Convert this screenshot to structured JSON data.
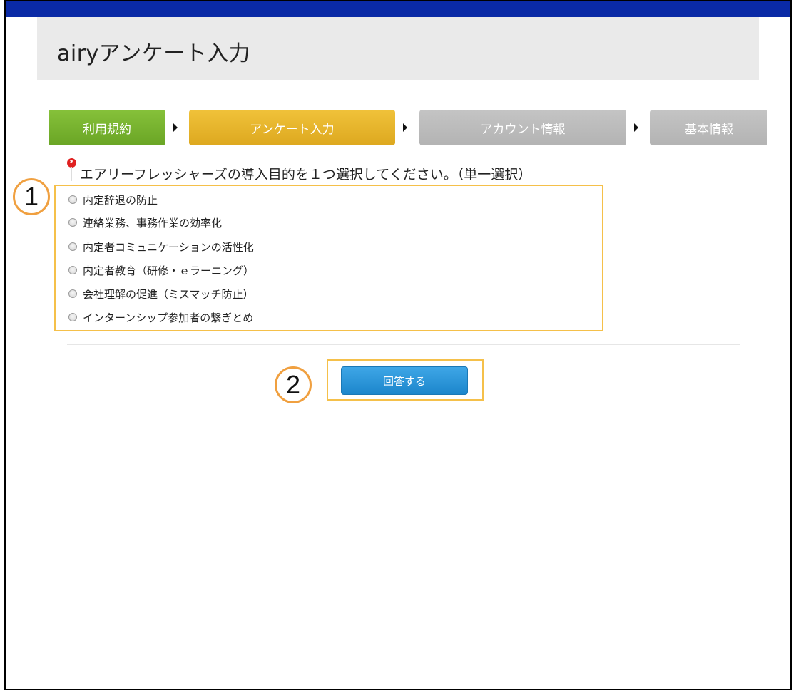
{
  "header": {
    "title": "airyアンケート入力"
  },
  "steps": [
    {
      "label": "利用規約",
      "state": "done",
      "color": "#7cb534"
    },
    {
      "label": "アンケート入力",
      "state": "current",
      "color": "#e8b92c"
    },
    {
      "label": "アカウント情報",
      "state": "upcoming",
      "color": "#bdbdbd"
    },
    {
      "label": "基本情報",
      "state": "upcoming",
      "color": "#bdbdbd"
    }
  ],
  "question": {
    "required_icon": "required-icon",
    "text": "エアリーフレッシャーズの導入目的を１つ選択してください。（単一選択）",
    "options": [
      {
        "label": "内定辞退の防止",
        "selected": false
      },
      {
        "label": "連絡業務、事務作業の効率化",
        "selected": false
      },
      {
        "label": "内定者コミュニケーションの活性化",
        "selected": false
      },
      {
        "label": "内定者教育（研修・ｅラーニング）",
        "selected": false
      },
      {
        "label": "会社理解の促進（ミスマッチ防止）",
        "selected": false
      },
      {
        "label": "インターンシップ参加者の繋ぎとめ",
        "selected": false
      }
    ]
  },
  "submit": {
    "label": "回答する"
  },
  "annotations": {
    "badge1": "1",
    "badge2": "2",
    "color": "#f0a040"
  },
  "colors": {
    "topbar": "#0a2aa6",
    "highlight": "#f5c04a",
    "button": "#2a96d8"
  }
}
